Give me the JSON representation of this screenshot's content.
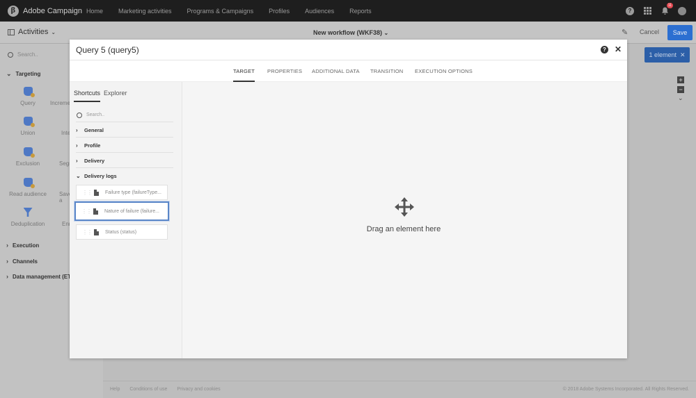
{
  "app": {
    "name": "Adobe Campaign",
    "logo_glyph": "β"
  },
  "topnav": [
    "Home",
    "Marketing activities",
    "Programs & Campaigns",
    "Profiles",
    "Audiences",
    "Reports"
  ],
  "top_icons": {
    "notification_count": "11"
  },
  "subbar": {
    "activities_label": "Activities",
    "workflow_title": "New workflow (WKF38)",
    "cancel_label": "Cancel",
    "save_label": "Save"
  },
  "palette": {
    "search_placeholder": "Search..",
    "sections": {
      "targeting": "Targeting",
      "execution": "Execution",
      "channels": "Channels",
      "data_management": "Data management (ETL)"
    },
    "activities": [
      "Query",
      "Incrementa",
      "Union",
      "Inters",
      "Exclusion",
      "Segme",
      "Read audience",
      "Save a",
      "Deduplication",
      "Enric"
    ]
  },
  "canvas": {
    "element_pill": "1 element"
  },
  "footer": {
    "links": [
      "Help",
      "Conditions of use",
      "Privacy and cookies"
    ],
    "copyright": "© 2018 Adobe Systems Incorporated. All Rights Reserved."
  },
  "modal": {
    "title": "Query 5 (query5)",
    "tabs": [
      "TARGET",
      "PROPERTIES",
      "ADDITIONAL DATA",
      "TRANSITION",
      "EXECUTION OPTIONS"
    ],
    "side_tabs": [
      "Shortcuts",
      "Explorer"
    ],
    "search_placeholder": "Search..",
    "tree": [
      "General",
      "Profile",
      "Delivery",
      "Delivery logs"
    ],
    "fields": [
      "Failure type (failureType...",
      "Nature of failure (failure...",
      "Status (status)"
    ],
    "drop_text": "Drag an element here"
  },
  "colors": {
    "accent": "#2c6fd1",
    "selected_border": "#5a86c8"
  }
}
